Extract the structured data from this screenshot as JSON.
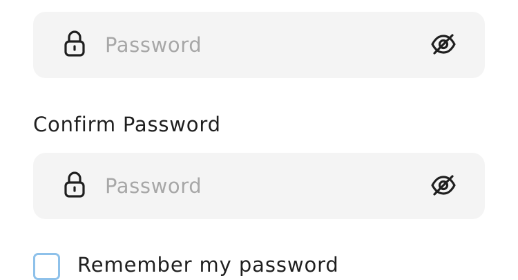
{
  "password_field": {
    "placeholder": "Password",
    "value": "",
    "lock_icon": "lock-icon",
    "toggle_icon": "eye-off-icon"
  },
  "confirm_section": {
    "label": "Confirm Password"
  },
  "confirm_field": {
    "placeholder": "Password",
    "value": "",
    "lock_icon": "lock-icon",
    "toggle_icon": "eye-off-icon"
  },
  "remember": {
    "label": "Remember my password",
    "checked": false
  },
  "colors": {
    "field_background": "#f4f4f4",
    "placeholder": "#a7a7a7",
    "checkbox_border": "#8ec1ea",
    "text": "#1f1f1f"
  }
}
